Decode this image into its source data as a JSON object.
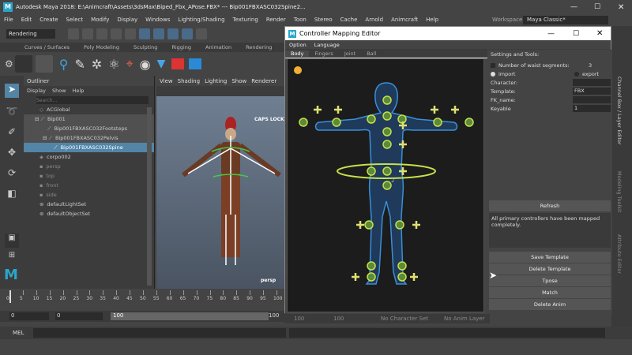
{
  "window": {
    "title": "Autodesk Maya 2018: E:\\Animcraft\\Assets\\3dsMax\\Biped_Fbx_APose.FBX*  ---  Bip001FBXASC032Spine2...",
    "workspace_label": "Workspace :",
    "workspace_value": "Maya Classic*"
  },
  "menubar": [
    "File",
    "Edit",
    "Create",
    "Select",
    "Modify",
    "Display",
    "Windows",
    "Lighting/Shading",
    "Texturing",
    "Render",
    "Toon",
    "Stereo",
    "Cache",
    "Arnold",
    "Animcraft",
    "Help"
  ],
  "mode_dropdown": "Rendering",
  "shelf_tabs": [
    "Curves / Surfaces",
    "Poly Modeling",
    "Sculpting",
    "Rigging",
    "Animation",
    "Rendering"
  ],
  "outliner": {
    "title": "Outliner",
    "menu": [
      "Display",
      "Show",
      "Help"
    ],
    "search_placeholder": "Search...",
    "items": [
      "ACGlobal",
      "Bip001",
      "Bip001FBXASC032Footsteps",
      "Bip001FBXASC032Pelvis",
      "Bip001FBXASC032Spine",
      "corpo002",
      "persp",
      "top",
      "front",
      "side",
      "defaultLightSet",
      "defaultObjectSet"
    ]
  },
  "viewport": {
    "menu": [
      "View",
      "Shading",
      "Lighting",
      "Show",
      "Renderer"
    ],
    "caps_lock": "CAPS LOCK",
    "camera": "persp"
  },
  "timeline": {
    "ticks": [
      "0",
      "5",
      "10",
      "15",
      "20",
      "25",
      "30",
      "35",
      "40",
      "45",
      "50",
      "55",
      "60",
      "65",
      "70",
      "75",
      "80",
      "85",
      "90",
      "95",
      "100"
    ],
    "start": "0",
    "end": "100",
    "range_start": "0",
    "range_end": "100",
    "range_max": "100"
  },
  "range_overlay": [
    "100",
    "100",
    "No Character Set",
    "No Anim Layer"
  ],
  "cmdline": {
    "label": "MEL"
  },
  "cme": {
    "title": "Controller Mapping Editor",
    "menu": [
      "Option",
      "Language"
    ],
    "tabs": [
      "Body",
      "Fingers",
      "Joint",
      "Ball"
    ],
    "settings_title": "Settings and Tools:",
    "waist_label": "Number of waist segments:",
    "waist_value": "3",
    "import_label": "import",
    "export_label": "export",
    "character_label": "Character:",
    "template_label": "Template:",
    "template_value": "FBX",
    "fk_label": "FK_name:",
    "keyable_label": "Keyable",
    "keyable_value": "1",
    "refresh": "Refresh",
    "message": "All primary controllers have been mapped completely.",
    "buttons": [
      "Save Template",
      "Delete Template",
      "Tpose",
      "Match",
      "Delete Anim"
    ],
    "canvas_label": "2"
  },
  "right_panel": [
    "Channel Box / Layer Editor",
    "Modeling Toolkit",
    "Attribute Editor"
  ],
  "colors": {
    "accent": "#5285a6",
    "controller_ring": "#c8e04a",
    "body_outline": "#3a8fd8",
    "body_fill": "#1f3a5a"
  }
}
